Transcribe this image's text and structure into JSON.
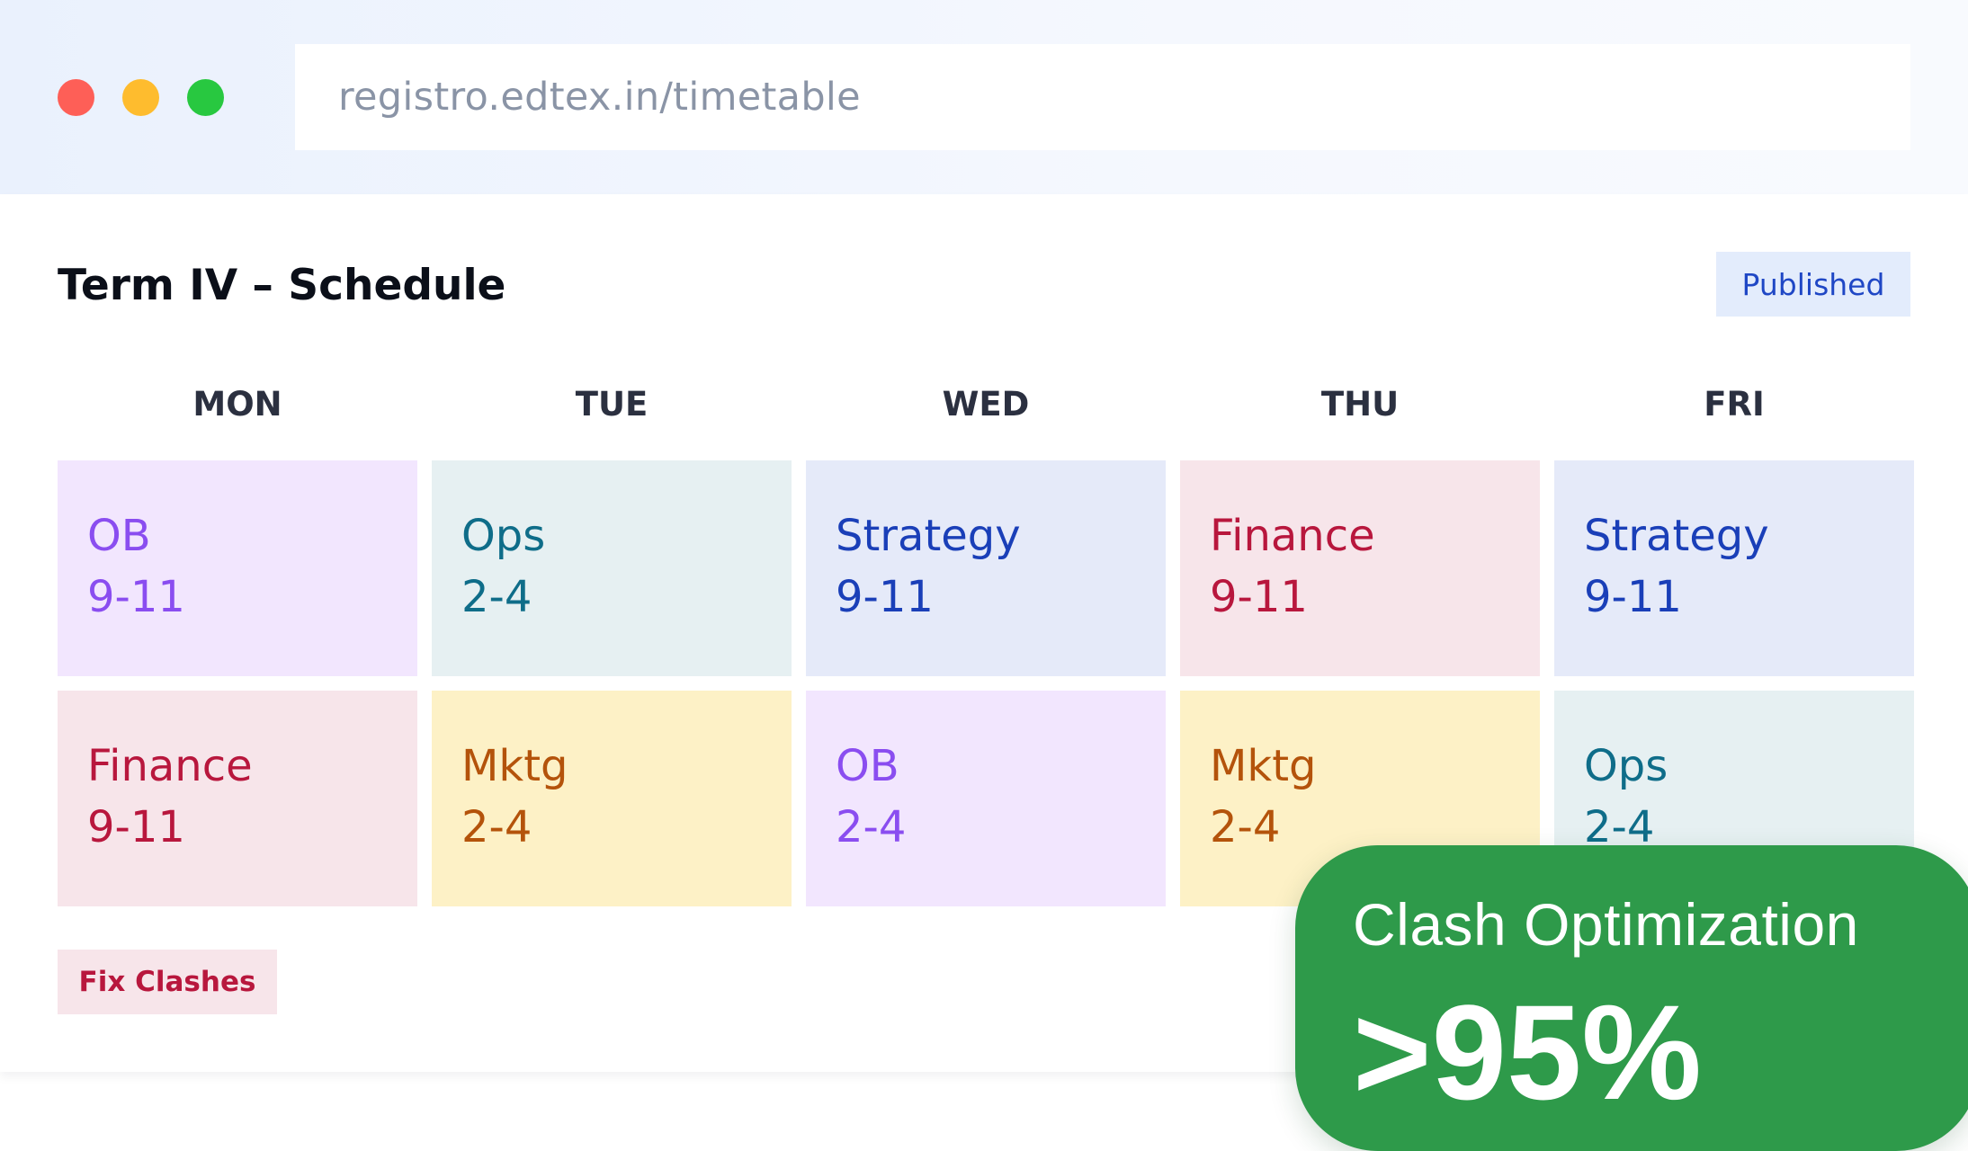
{
  "browser": {
    "url": "registro.edtex.in/timetable",
    "window_buttons": [
      "close",
      "minimize",
      "maximize"
    ]
  },
  "page": {
    "title": "Term IV – Schedule",
    "status_badge": "Published",
    "fix_button_label": "Fix Clashes"
  },
  "schedule": {
    "days": [
      "MON",
      "TUE",
      "WED",
      "THU",
      "FRI"
    ],
    "rows": [
      [
        {
          "course": "OB",
          "time": "9-11",
          "color": "purple"
        },
        {
          "course": "Ops",
          "time": "2-4",
          "color": "teal"
        },
        {
          "course": "Strategy",
          "time": "9-11",
          "color": "blue"
        },
        {
          "course": "Finance",
          "time": "9-11",
          "color": "red"
        },
        {
          "course": "Strategy",
          "time": "9-11",
          "color": "blue"
        }
      ],
      [
        {
          "course": "Finance",
          "time": "9-11",
          "color": "red"
        },
        {
          "course": "Mktg",
          "time": "2-4",
          "color": "yellow"
        },
        {
          "course": "OB",
          "time": "2-4",
          "color": "purple"
        },
        {
          "course": "Mktg",
          "time": "2-4",
          "color": "yellow"
        },
        {
          "course": "Ops",
          "time": "2-4",
          "color": "teal"
        }
      ]
    ]
  },
  "metric": {
    "label": "Clash Optimization",
    "value": ">95%"
  },
  "colors": {
    "purple": "#8a4df0",
    "teal": "#0f6d89",
    "blue": "#1a3fb8",
    "red": "#b8173d",
    "yellow": "#b4530b",
    "metric_bg": "#2e9a4a",
    "badge_text": "#1f47c5"
  }
}
